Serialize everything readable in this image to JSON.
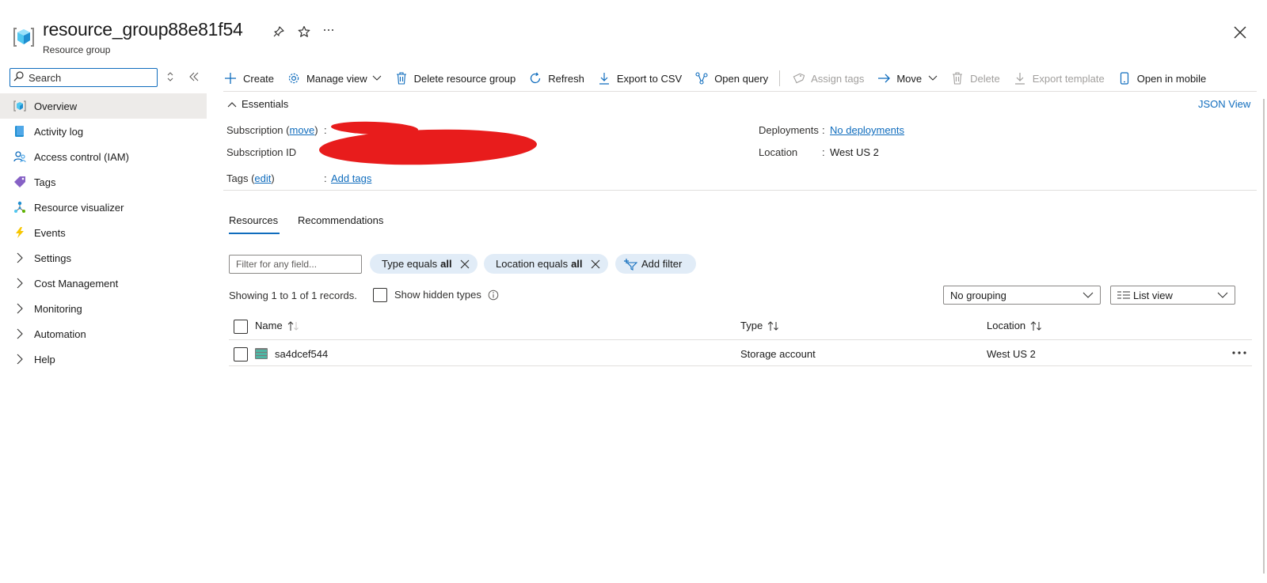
{
  "header": {
    "title": "resource_group88e81f54",
    "subtitle": "Resource group",
    "pin_icon": "pin-icon",
    "favorite_icon": "star-icon",
    "more_icon": "ellipsis-icon",
    "close_icon": "close-icon"
  },
  "sidebar": {
    "search_placeholder": "Search",
    "items": [
      {
        "label": "Overview",
        "icon": "resource-group-icon"
      },
      {
        "label": "Activity log",
        "icon": "activity-log-icon"
      },
      {
        "label": "Access control (IAM)",
        "icon": "iam-icon"
      },
      {
        "label": "Tags",
        "icon": "tag-icon"
      },
      {
        "label": "Resource visualizer",
        "icon": "visualizer-icon"
      },
      {
        "label": "Events",
        "icon": "lightning-icon"
      },
      {
        "label": "Settings",
        "icon": "chevron-right-icon"
      },
      {
        "label": "Cost Management",
        "icon": "chevron-right-icon"
      },
      {
        "label": "Monitoring",
        "icon": "chevron-right-icon"
      },
      {
        "label": "Automation",
        "icon": "chevron-right-icon"
      },
      {
        "label": "Help",
        "icon": "chevron-right-icon"
      }
    ]
  },
  "toolbar": {
    "create": "Create",
    "manage_view": "Manage view",
    "delete_rg": "Delete resource group",
    "refresh": "Refresh",
    "export_csv": "Export to CSV",
    "open_query": "Open query",
    "assign_tags": "Assign tags",
    "move": "Move",
    "delete": "Delete",
    "export_template": "Export template",
    "open_mobile": "Open in mobile"
  },
  "essentials": {
    "heading": "Essentials",
    "json_view": "JSON View",
    "subscription_label": "Subscription",
    "subscription_move": "move",
    "subscription_id_label": "Subscription ID",
    "tags_label": "Tags",
    "tags_edit": "edit",
    "tags_value": "Add tags",
    "deployments_label": "Deployments",
    "deployments_value": "No deployments",
    "location_label": "Location",
    "location_value": "West US 2",
    "colon": ":"
  },
  "tabs": [
    {
      "label": "Resources",
      "active": true
    },
    {
      "label": "Recommendations",
      "active": false
    }
  ],
  "filters": {
    "placeholder": "Filter for any field...",
    "type_pill_label": "Type equals",
    "type_pill_value": "all",
    "location_pill_label": "Location equals",
    "location_pill_value": "all",
    "add_filter": "Add filter"
  },
  "records": {
    "text": "Showing 1 to 1 of 1 records.",
    "show_hidden": "Show hidden types",
    "grouping": "No grouping",
    "view": "List view"
  },
  "table": {
    "columns": [
      "Name",
      "Type",
      "Location"
    ],
    "rows": [
      {
        "name": "sa4dcef544",
        "type": "Storage account",
        "location": "West US 2"
      }
    ]
  },
  "colors": {
    "accent": "#0f6cbd",
    "pill_bg": "#e1ecf7",
    "redaction": "#e81c1c"
  }
}
